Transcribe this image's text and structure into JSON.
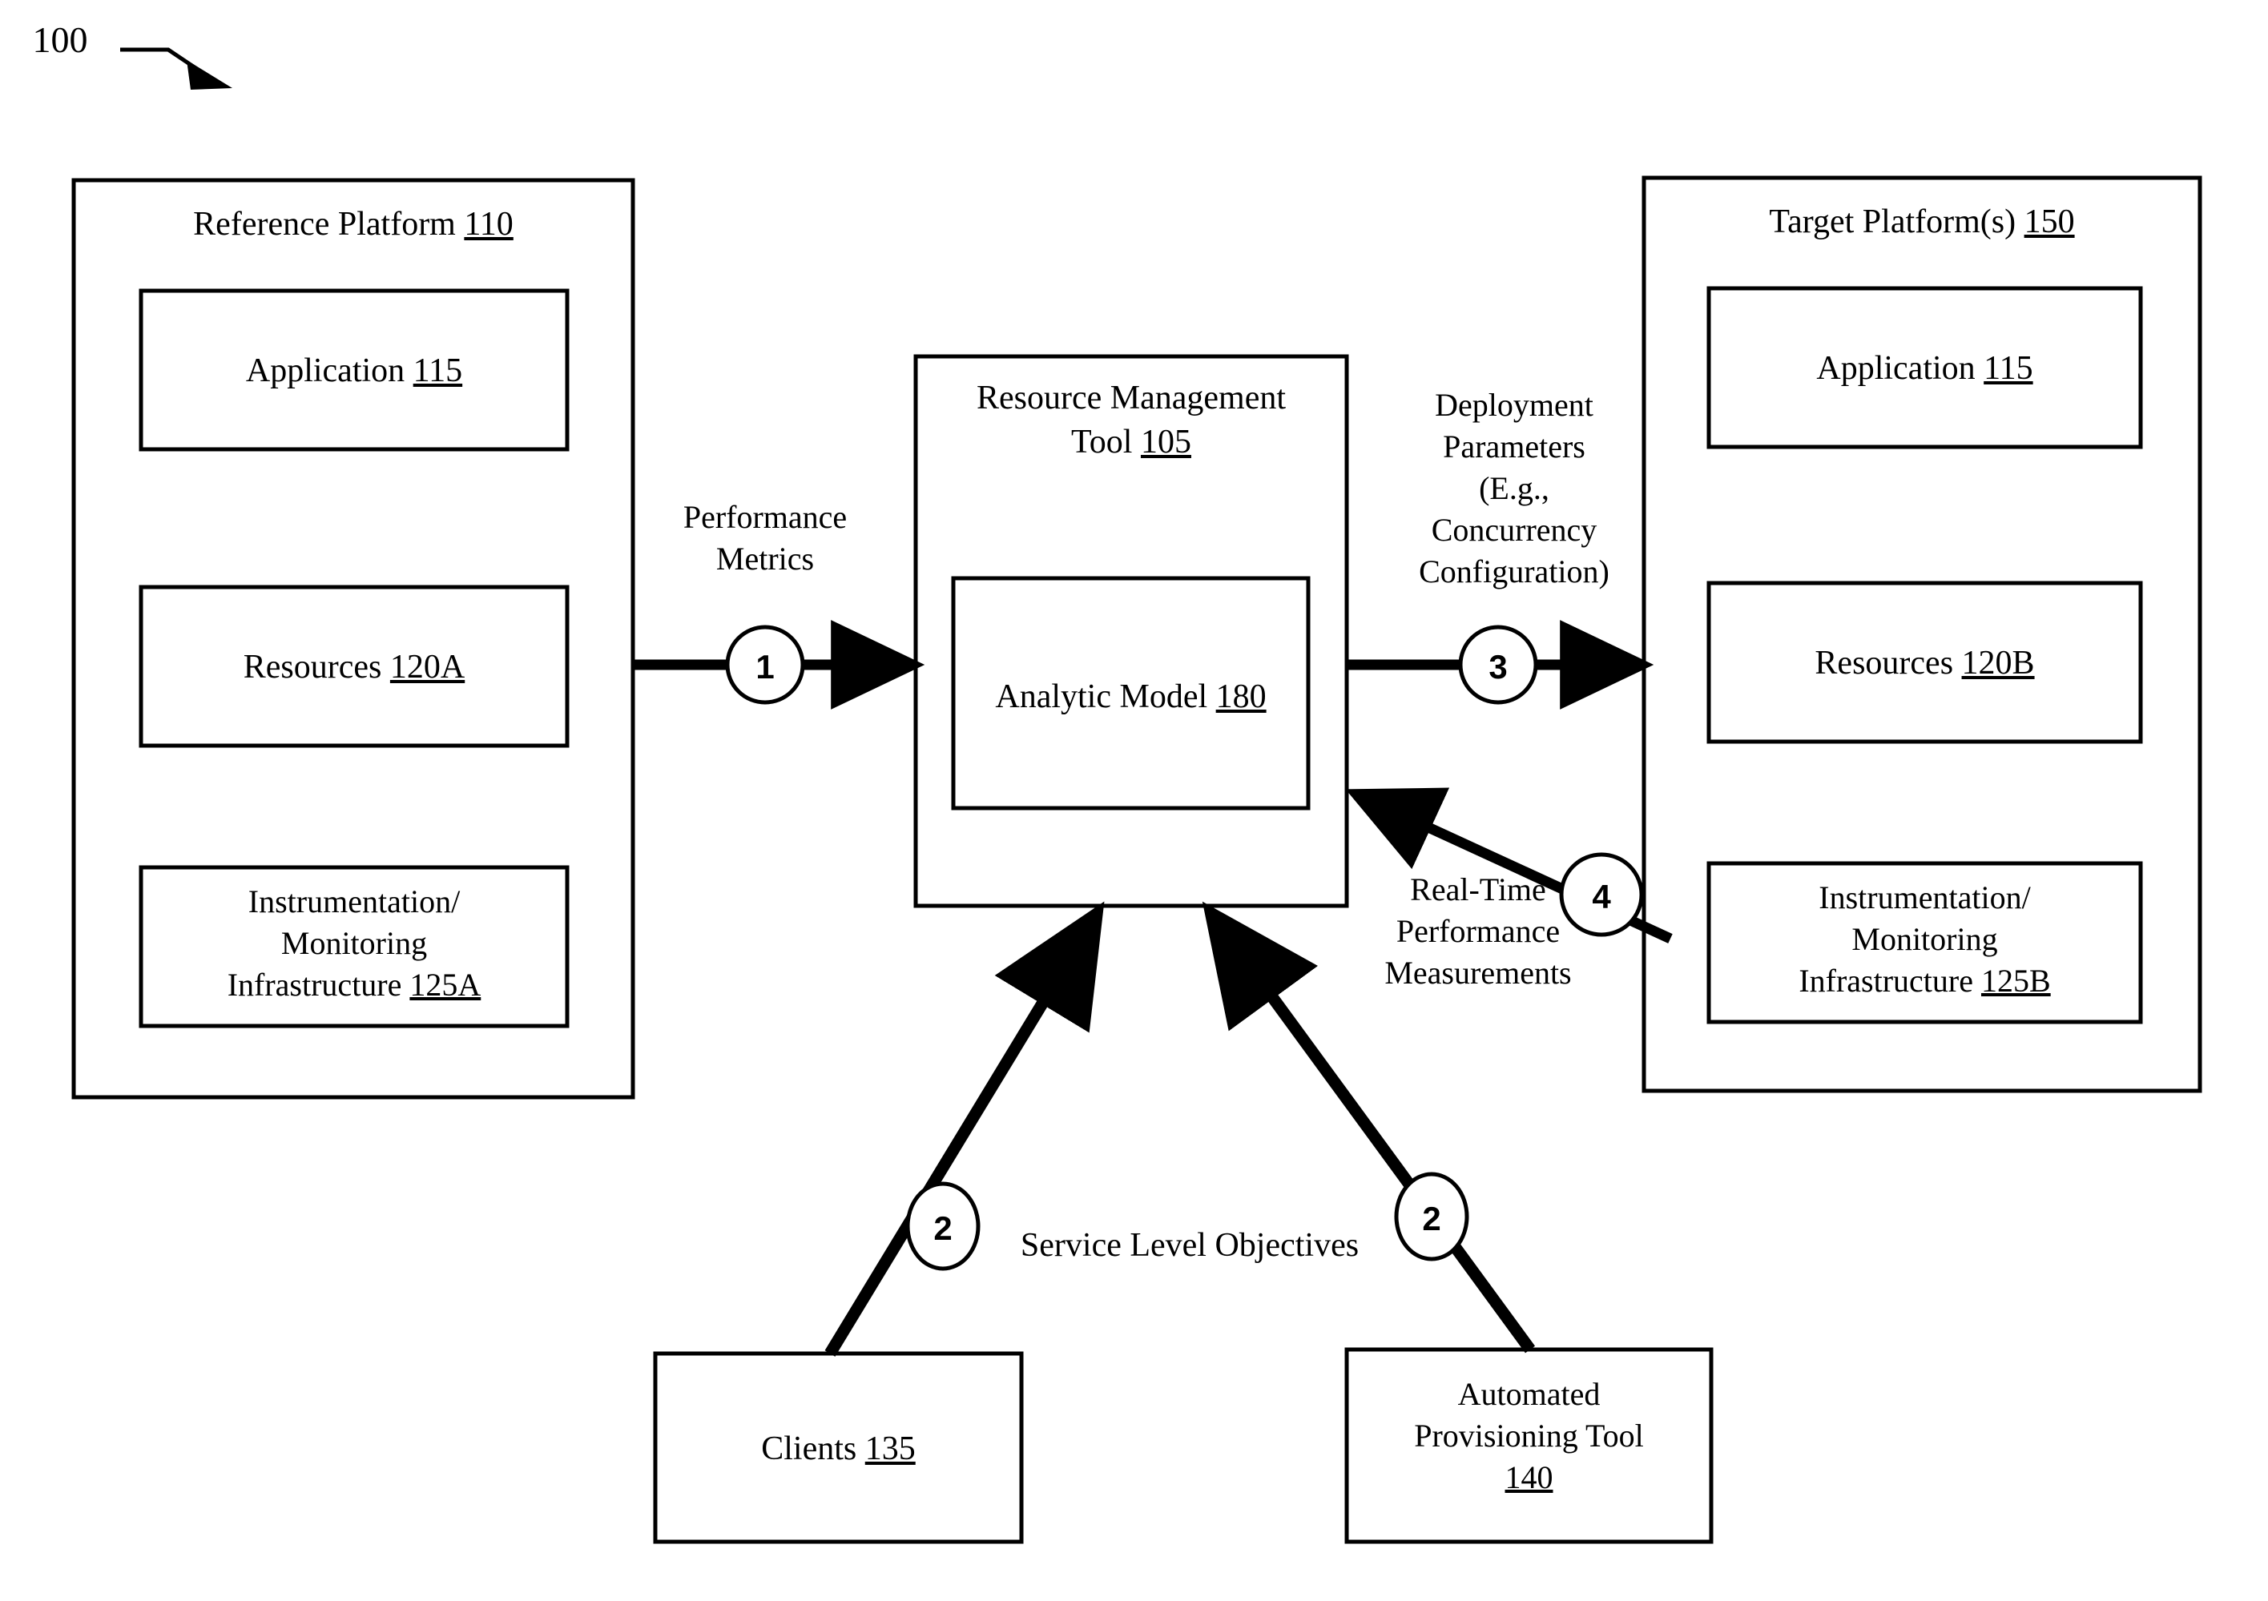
{
  "figure": {
    "number": "100",
    "type": "patent-block-diagram"
  },
  "left_panel": {
    "title_text": "Reference Platform ",
    "title_ref": "110",
    "boxes": [
      {
        "text": "Application ",
        "ref": "115",
        "lines": [
          "Application 115"
        ]
      },
      {
        "text": "Resources ",
        "ref": "120A",
        "lines": [
          "Resources 120A"
        ]
      },
      {
        "line1": "Instrumentation/",
        "line2": "Monitoring",
        "line3": "Infrastructure ",
        "ref": "125A"
      }
    ]
  },
  "center_panel": {
    "title_line1": "Resource Management",
    "title_line2": "Tool ",
    "title_ref": "105",
    "inner_box": {
      "text": "Analytic Model ",
      "ref": "180"
    }
  },
  "right_panel": {
    "title_text": "Target Platform(s) ",
    "title_ref": "150",
    "boxes": [
      {
        "text": "Application ",
        "ref": "115"
      },
      {
        "text": "Resources ",
        "ref": "120B"
      },
      {
        "line1": "Instrumentation/",
        "line2": "Monitoring",
        "line3": "Infrastructure ",
        "ref": "125B"
      }
    ]
  },
  "bottom_boxes": {
    "clients": {
      "text": "Clients ",
      "ref": "135"
    },
    "provisioning": {
      "line1": "Automated",
      "line2": "Provisioning Tool",
      "ref": "140"
    }
  },
  "flow_labels": {
    "performance_metrics_line1": "Performance",
    "performance_metrics_line2": "Metrics",
    "deployment_line1": "Deployment",
    "deployment_line2": "Parameters",
    "deployment_line3": "(E.g.,",
    "deployment_line4": "Concurrency",
    "deployment_line5": "Configuration)",
    "realtime_line1": "Real-Time",
    "realtime_line2": "Performance",
    "realtime_line3": "Measurements",
    "service_level_objectives": "Service Level Objectives"
  },
  "step_markers": {
    "one": "1",
    "two_left": "2",
    "two_right": "2",
    "three": "3",
    "four": "4"
  },
  "colors": {
    "stroke": "#000000",
    "background": "#ffffff"
  }
}
